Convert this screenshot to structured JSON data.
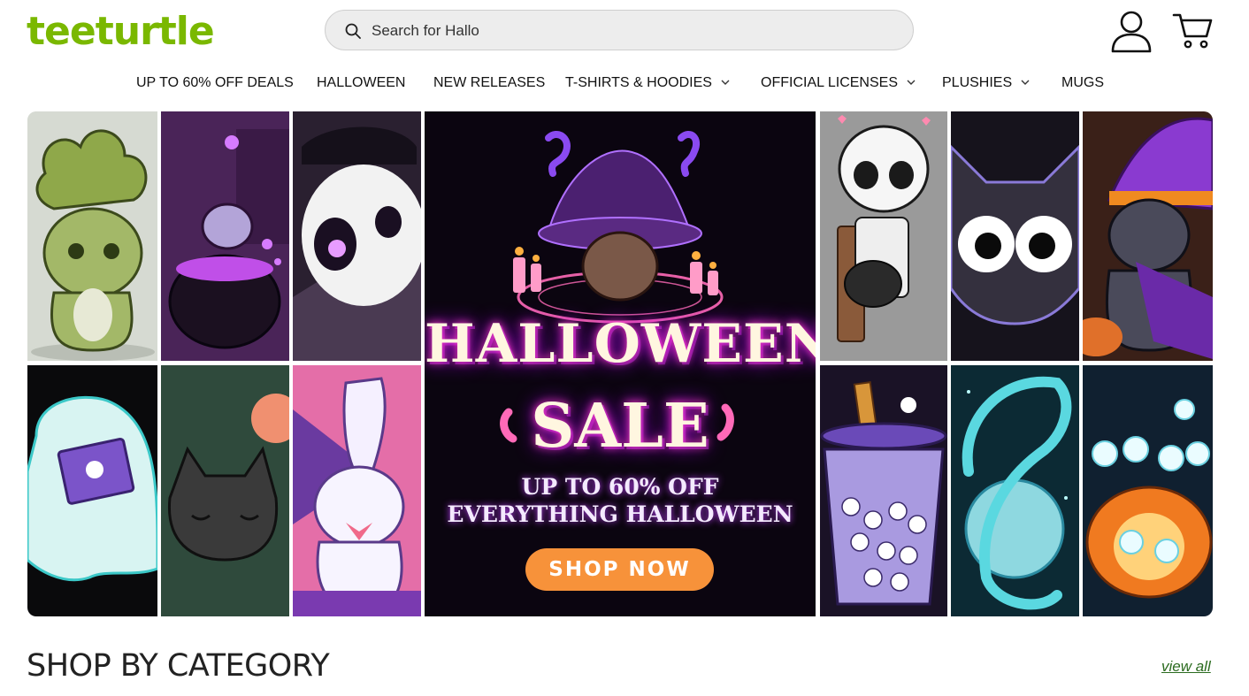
{
  "header": {
    "logo_text": "teeturtle",
    "search": {
      "value": "Search for Hallo",
      "placeholder": "Search for Hallo"
    },
    "account_icon": "person-icon",
    "cart_icon": "cart-icon"
  },
  "nav": {
    "items": [
      {
        "label": "UP TO 60% OFF DEALS",
        "has_dropdown": false
      },
      {
        "label": "HALLOWEEN",
        "has_dropdown": false
      },
      {
        "label": "NEW RELEASES",
        "has_dropdown": false
      },
      {
        "label": "T-SHIRTS & HOODIES",
        "has_dropdown": true
      },
      {
        "label": "OFFICIAL LICENSES",
        "has_dropdown": true
      },
      {
        "label": "PLUSHIES",
        "has_dropdown": true
      },
      {
        "label": "MUGS",
        "has_dropdown": false
      }
    ]
  },
  "hero": {
    "headline_1": "HALLOWEEN",
    "headline_2": "SALE",
    "sub_1": "UP TO 60% OFF",
    "sub_2": "EVERYTHING HALLOWEEN",
    "cta": "SHOP NOW"
  },
  "category_section": {
    "title": "SHOP BY CATEGORY",
    "view_all": "view all"
  },
  "colors": {
    "brand_green": "#7ab800",
    "cta_orange": "#f7923a",
    "link_green": "#2b6b1f"
  }
}
